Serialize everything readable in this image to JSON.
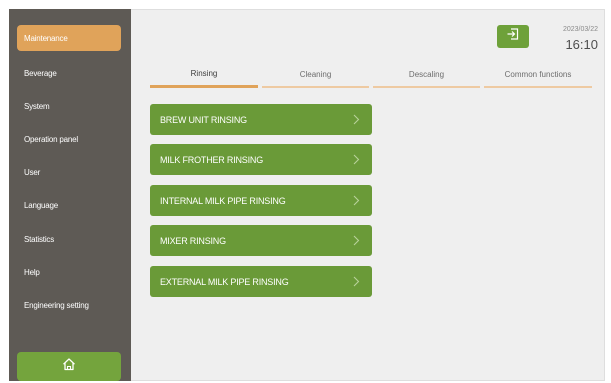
{
  "sidebar": {
    "items": [
      {
        "label": "Maintenance",
        "active": true
      },
      {
        "label": "Beverage",
        "active": false
      },
      {
        "label": "System",
        "active": false
      },
      {
        "label": "Operation panel",
        "active": false
      },
      {
        "label": "User",
        "active": false
      },
      {
        "label": "Language",
        "active": false
      },
      {
        "label": "Statistics",
        "active": false
      },
      {
        "label": "Help",
        "active": false
      },
      {
        "label": "Engineering setting",
        "active": false
      }
    ],
    "home_icon": "home-icon"
  },
  "header": {
    "logout_icon": "logout-icon",
    "date": "2023/03/22",
    "time": "16:10"
  },
  "tabs": [
    {
      "label": "Rinsing",
      "active": true
    },
    {
      "label": "Cleaning",
      "active": false
    },
    {
      "label": "Descaling",
      "active": false
    },
    {
      "label": "Common functions",
      "active": false
    }
  ],
  "actions": [
    {
      "label": "BREW UNIT RINSING"
    },
    {
      "label": "MILK FROTHER RINSING"
    },
    {
      "label": "INTERNAL MILK PIPE RINSING"
    },
    {
      "label": "MIXER RINSING"
    },
    {
      "label": "EXTERNAL MILK PIPE RINSING"
    }
  ],
  "colors": {
    "sidebar_bg": "#5e5a55",
    "accent_orange": "#e0a35a",
    "accent_green": "#6a9a38",
    "content_bg": "#efefef"
  }
}
